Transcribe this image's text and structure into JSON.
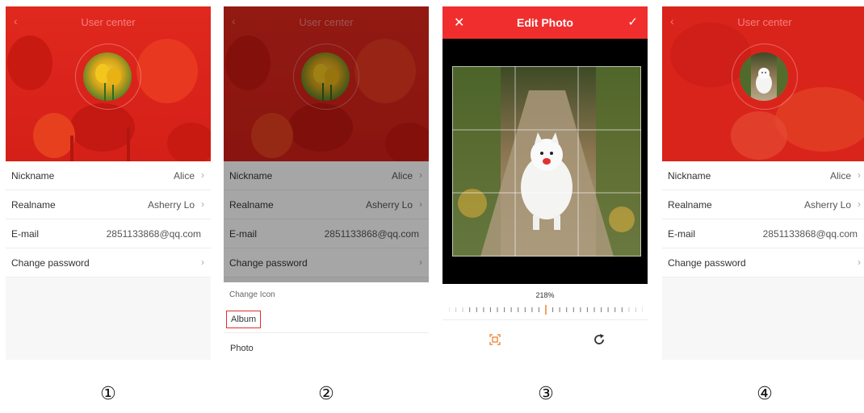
{
  "screens": [
    {
      "title": "User center",
      "rows": [
        {
          "label": "Nickname",
          "value": "Alice",
          "arrow": true
        },
        {
          "label": "Realname",
          "value": "Asherry Lo",
          "arrow": true
        },
        {
          "label": "E-mail",
          "value": "2851133868@qq.com",
          "arrow": false
        },
        {
          "label": "Change password",
          "value": "",
          "arrow": true
        }
      ],
      "caption": "①"
    },
    {
      "title": "User center",
      "rows": [
        {
          "label": "Nickname",
          "value": "Alice",
          "arrow": true
        },
        {
          "label": "Realname",
          "value": "Asherry Lo",
          "arrow": true
        },
        {
          "label": "E-mail",
          "value": "2851133868@qq.com",
          "arrow": false
        },
        {
          "label": "Change password",
          "value": "",
          "arrow": true
        }
      ],
      "sheet": {
        "title": "Change Icon",
        "album": "Album",
        "photo": "Photo"
      },
      "caption": "②"
    },
    {
      "title": "Edit Photo",
      "zoom": "218%",
      "caption": "③"
    },
    {
      "title": "User center",
      "rows": [
        {
          "label": "Nickname",
          "value": "Alice",
          "arrow": true
        },
        {
          "label": "Realname",
          "value": "Asherry Lo",
          "arrow": true
        },
        {
          "label": "E-mail",
          "value": "2851133868@qq.com",
          "arrow": false
        },
        {
          "label": "Change password",
          "value": "",
          "arrow": true
        }
      ],
      "caption": "④"
    }
  ],
  "icons": {
    "arrow": "›",
    "back": "‹",
    "close": "✕",
    "confirm": "✓"
  },
  "colors": {
    "header_red": "#e8231f",
    "accent": "#f02e2e",
    "highlight_border": "#e52b2b",
    "crop_orange": "#f28a3a"
  }
}
